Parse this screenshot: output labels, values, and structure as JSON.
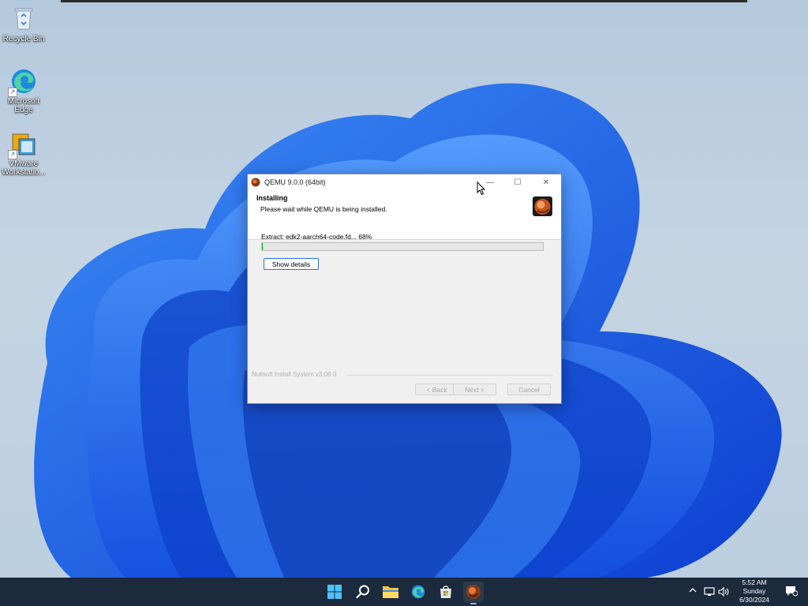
{
  "desktop": {
    "icons": [
      {
        "id": "recycle-bin",
        "label": "Recycle Bin"
      },
      {
        "id": "microsoft-edge",
        "label": "Microsoft\nEdge"
      },
      {
        "id": "vmware-workstation",
        "label": "VMware\nWorkstatio..."
      }
    ]
  },
  "installer": {
    "window_title": "QEMU 9.0.0 (64bit)",
    "controls": {
      "minimize": "—",
      "maximize": "☐",
      "close": "✕"
    },
    "header_title": "Installing",
    "header_subtitle": "Please wait while QEMU is being installed.",
    "status_text": "Extract: edk2-aarch64-code.fd... 68%",
    "progress_fraction": 0.004,
    "show_details_label": "Show details",
    "branding": "Nullsoft Install System v3.08-3",
    "back_label": "< Back",
    "next_label": "Next >",
    "cancel_label": "Cancel"
  },
  "taskbar": {
    "apps": [
      "start-icon",
      "search-icon",
      "file-explorer-icon",
      "edge-icon",
      "store-icon",
      "qemu-icon"
    ],
    "clock": {
      "time": "5:52 AM",
      "day": "Sunday",
      "date": "6/30/2024"
    }
  },
  "colors": {
    "accent_blue": "#1f6fe5",
    "progress_green": "#06b025",
    "taskbar_bg": "#1c2a3d"
  }
}
